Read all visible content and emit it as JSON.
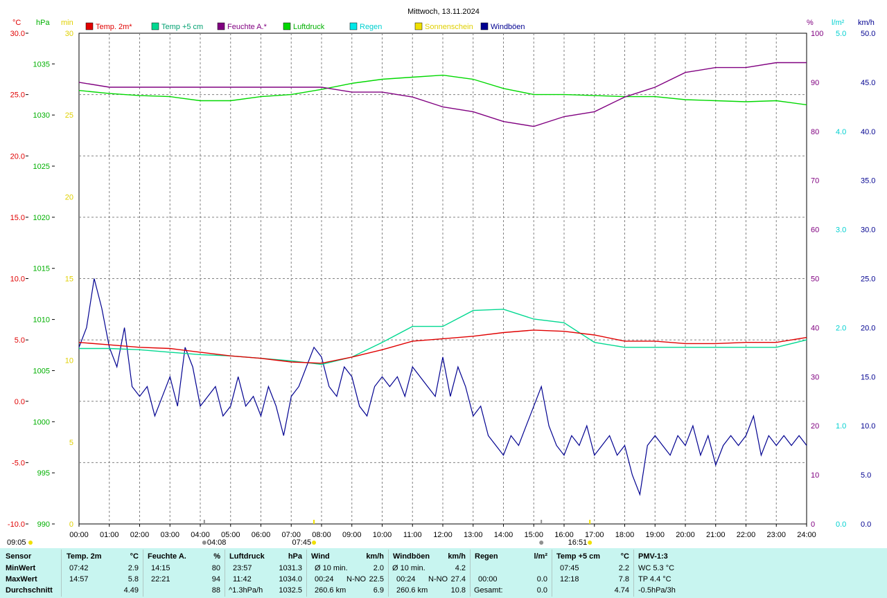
{
  "title": "Mittwoch, 13.11.2024",
  "colors": {
    "temp2m": "#e00000",
    "temp5cm": "#00d890",
    "humidity": "#800080",
    "pressure": "#00d800",
    "rain": "#00e8e8",
    "sun": "#f0e000",
    "gust": "#000090",
    "stats_bg": "#c8f5f0"
  },
  "legend": [
    {
      "label": "Temp. 2m*",
      "color": "#e00000",
      "text_color": "#e00000"
    },
    {
      "label": "Temp +5 cm",
      "color": "#00d890",
      "text_color": "#00a070"
    },
    {
      "label": "Feuchte A.*",
      "color": "#800080",
      "text_color": "#800080"
    },
    {
      "label": "Luftdruck",
      "color": "#00d800",
      "text_color": "#00b000"
    },
    {
      "label": "Regen",
      "color": "#00e8e8",
      "text_color": "#00d0d0"
    },
    {
      "label": "Sonnenschein",
      "color": "#f0e000",
      "text_color": "#e0d000"
    },
    {
      "label": "Windböen",
      "color": "#000090",
      "text_color": "#000090"
    }
  ],
  "axis_units": {
    "temp": "°C",
    "pressure": "hPa",
    "sun": "min",
    "humidity": "%",
    "rain": "l/m²",
    "wind": "km/h"
  },
  "axis_ticks": {
    "temp": [
      "30.0",
      "25.0",
      "20.0",
      "15.0",
      "10.0",
      "5.0",
      "0.0",
      "-5.0",
      "-10.0"
    ],
    "pressure": [
      "1035",
      "1030",
      "1025",
      "1020",
      "1015",
      "1010",
      "1005",
      "1000",
      "995",
      "990"
    ],
    "sun": [
      "30",
      "25",
      "20",
      "15",
      "10",
      "5",
      "0"
    ],
    "humidity": [
      "100",
      "90",
      "80",
      "70",
      "60",
      "50",
      "40",
      "30",
      "20",
      "10",
      "0"
    ],
    "rain": [
      "5.0",
      "4.0",
      "3.0",
      "2.0",
      "1.0",
      "0.0"
    ],
    "wind": [
      "50.0",
      "45.0",
      "40.0",
      "35.0",
      "30.0",
      "25.0",
      "20.0",
      "15.0",
      "10.0",
      "5.0",
      "0.0"
    ]
  },
  "x_ticks": [
    "00:00",
    "01:00",
    "02:00",
    "03:00",
    "04:00",
    "05:00",
    "06:00",
    "07:00",
    "08:00",
    "09:00",
    "10:00",
    "11:00",
    "12:00",
    "13:00",
    "14:00",
    "15:00",
    "16:00",
    "17:00",
    "18:00",
    "19:00",
    "20:00",
    "21:00",
    "22:00",
    "23:00",
    "24:00"
  ],
  "markers": {
    "sunrise": "07:45",
    "sunset": "16:51",
    "moonrise": "09:05",
    "moonset": "04:08",
    "moon_other": "15:15"
  },
  "chart_data": {
    "type": "line",
    "title": "Mittwoch, 13.11.2024",
    "x_range": [
      "00:00",
      "24:00"
    ],
    "ylim_temp": [
      -10,
      30
    ],
    "ylim_pressure": [
      990,
      1038
    ],
    "ylim_humidity": [
      0,
      100
    ],
    "ylim_wind": [
      0,
      50
    ],
    "ylim_rain": [
      0,
      5
    ],
    "ylim_sun": [
      0,
      30
    ],
    "grid": true,
    "series": [
      {
        "name": "Temp. 2m*",
        "axis": "temp",
        "x": [
          0,
          1,
          2,
          3,
          4,
          5,
          6,
          7,
          8,
          9,
          10,
          11,
          12,
          13,
          14,
          15,
          16,
          17,
          18,
          19,
          20,
          21,
          22,
          23,
          24
        ],
        "y": [
          4.8,
          4.6,
          4.4,
          4.3,
          4.0,
          3.7,
          3.5,
          3.2,
          3.1,
          3.6,
          4.2,
          4.9,
          5.1,
          5.3,
          5.6,
          5.8,
          5.7,
          5.4,
          4.9,
          4.9,
          4.7,
          4.7,
          4.8,
          4.8,
          5.2
        ]
      },
      {
        "name": "Temp +5 cm",
        "axis": "temp",
        "x": [
          0,
          1,
          2,
          3,
          4,
          5,
          6,
          7,
          8,
          9,
          10,
          11,
          12,
          13,
          14,
          15,
          16,
          17,
          18,
          19,
          20,
          21,
          22,
          23,
          24
        ],
        "y": [
          4.3,
          4.3,
          4.2,
          4.0,
          3.8,
          3.7,
          3.5,
          3.3,
          3.0,
          3.6,
          4.8,
          6.1,
          6.1,
          7.4,
          7.5,
          6.7,
          6.4,
          4.8,
          4.4,
          4.4,
          4.4,
          4.4,
          4.4,
          4.4,
          5.0
        ]
      },
      {
        "name": "Feuchte A.*",
        "axis": "humidity",
        "x": [
          0,
          1,
          2,
          3,
          4,
          5,
          6,
          7,
          8,
          9,
          10,
          11,
          12,
          13,
          14,
          15,
          16,
          17,
          18,
          19,
          20,
          21,
          22,
          23,
          24
        ],
        "y": [
          90,
          89,
          89,
          89,
          89,
          89,
          89,
          89,
          89,
          88,
          88,
          87,
          85,
          84,
          82,
          81,
          83,
          84,
          87,
          89,
          92,
          93,
          93,
          94,
          94
        ]
      },
      {
        "name": "Luftdruck",
        "axis": "pressure",
        "x": [
          0,
          1,
          2,
          3,
          4,
          5,
          6,
          7,
          8,
          9,
          10,
          11,
          12,
          13,
          14,
          15,
          16,
          17,
          18,
          19,
          20,
          21,
          22,
          23,
          24
        ],
        "y": [
          1032.4,
          1032.1,
          1031.9,
          1031.8,
          1031.4,
          1031.4,
          1031.8,
          1032.0,
          1032.5,
          1033.1,
          1033.5,
          1033.7,
          1033.9,
          1033.5,
          1032.6,
          1032.0,
          1032.0,
          1031.9,
          1031.8,
          1031.8,
          1031.5,
          1031.4,
          1031.3,
          1031.4,
          1031.0
        ]
      },
      {
        "name": "Windböen",
        "axis": "wind",
        "x": [
          0,
          0.25,
          0.5,
          0.75,
          1,
          1.25,
          1.5,
          1.75,
          2,
          2.25,
          2.5,
          2.75,
          3,
          3.25,
          3.5,
          3.75,
          4,
          4.25,
          4.5,
          4.75,
          5,
          5.25,
          5.5,
          5.75,
          6,
          6.25,
          6.5,
          6.75,
          7,
          7.25,
          7.5,
          7.75,
          8,
          8.25,
          8.5,
          8.75,
          9,
          9.25,
          9.5,
          9.75,
          10,
          10.25,
          10.5,
          10.75,
          11,
          11.25,
          11.5,
          11.75,
          12,
          12.25,
          12.5,
          12.75,
          13,
          13.25,
          13.5,
          13.75,
          14,
          14.25,
          14.5,
          14.75,
          15,
          15.25,
          15.5,
          15.75,
          16,
          16.25,
          16.5,
          16.75,
          17,
          17.25,
          17.5,
          17.75,
          18,
          18.25,
          18.5,
          18.75,
          19,
          19.25,
          19.5,
          19.75,
          20,
          20.25,
          20.5,
          20.75,
          21,
          21.25,
          21.5,
          21.75,
          22,
          22.25,
          22.5,
          22.75,
          23,
          23.25,
          23.5,
          23.75,
          24
        ],
        "y": [
          18,
          20,
          25,
          22,
          18,
          16,
          20,
          14,
          13,
          14,
          11,
          13,
          15,
          12,
          18,
          16,
          12,
          13,
          14,
          11,
          12,
          15,
          12,
          13,
          11,
          14,
          12,
          9,
          13,
          14,
          16,
          18,
          17,
          14,
          13,
          16,
          15,
          12,
          11,
          14,
          15,
          14,
          15,
          13,
          16,
          15,
          14,
          13,
          17,
          13,
          16,
          14,
          11,
          12,
          9,
          8,
          7,
          9,
          8,
          10,
          12,
          14,
          10,
          8,
          7,
          9,
          8,
          10,
          7,
          8,
          9,
          7,
          8,
          5,
          3,
          8,
          9,
          8,
          7,
          9,
          8,
          10,
          7,
          9,
          6,
          8,
          9,
          8,
          9,
          11,
          7,
          9,
          8,
          9,
          8,
          9,
          8
        ]
      }
    ]
  },
  "stats": {
    "headers": [
      "Sensor",
      "Temp. 2m",
      "°C",
      "Feuchte A.",
      "%",
      "Luftdruck",
      "hPa",
      "Wind",
      "km/h",
      "Windböen",
      "km/h",
      "Regen",
      "l/m²",
      "Temp +5 cm",
      "°C",
      "PMV-1:3"
    ],
    "rows": {
      "min": {
        "label": "MinWert",
        "temp_time": "07:42",
        "temp_val": "2.9",
        "hum_time": "14:15",
        "hum_val": "80",
        "press_time": "23:57",
        "press_val": "1031.3",
        "wind_a": "Ø 10 min.",
        "wind_b": "",
        "wind_val": "2.0",
        "gust_a": "Ø 10 min.",
        "gust_b": "",
        "gust_val": "4.2",
        "rain_a": "",
        "rain_val": "",
        "t5_time": "07:45",
        "t5_val": "2.2",
        "pmv": "WC 5.3 °C"
      },
      "max": {
        "label": "MaxWert",
        "temp_time": "14:57",
        "temp_val": "5.8",
        "hum_time": "22:21",
        "hum_val": "94",
        "press_time": "11:42",
        "press_val": "1034.0",
        "wind_a": "00:24",
        "wind_b": "N-NO",
        "wind_val": "22.5",
        "gust_a": "00:24",
        "gust_b": "N-NO",
        "gust_val": "27.4",
        "rain_a": "00:00",
        "rain_val": "0.0",
        "t5_time": "12:18",
        "t5_val": "7.8",
        "pmv": "TP 4.4 °C"
      },
      "avg": {
        "label": "Durchschnitt",
        "temp_time": "",
        "temp_val": "4.49",
        "hum_time": "",
        "hum_val": "88",
        "press_time": "^1.3hPa/h",
        "press_val": "1032.5",
        "wind_a": "260.6 km",
        "wind_b": "",
        "wind_val": "6.9",
        "gust_a": "260.6 km",
        "gust_b": "",
        "gust_val": "10.8",
        "rain_a": "Gesamt:",
        "rain_val": "0.0",
        "t5_time": "",
        "t5_val": "4.74",
        "pmv": "-0.5hPa/3h"
      }
    }
  }
}
